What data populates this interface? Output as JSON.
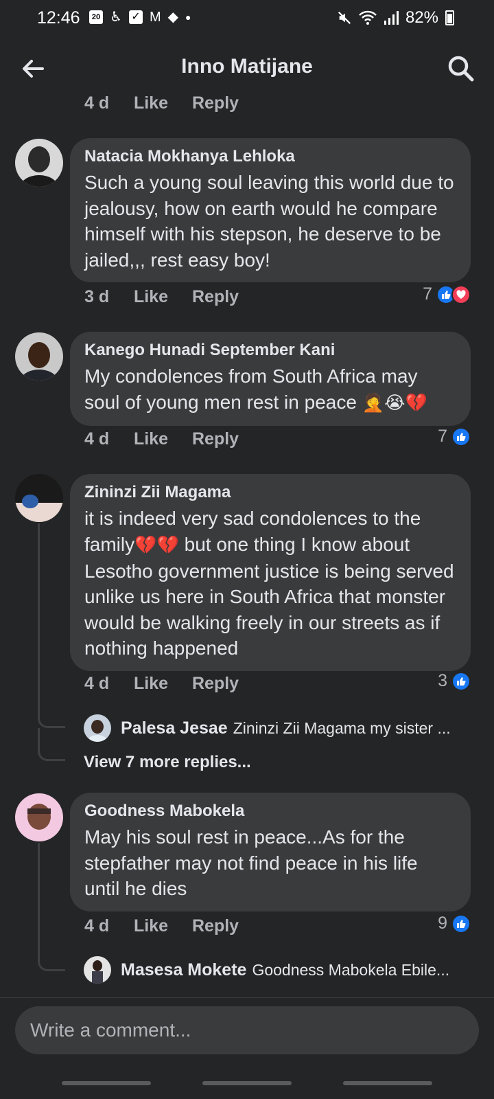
{
  "status_bar": {
    "time": "12:46",
    "battery": "82%",
    "notification_icons": [
      "calendar-icon",
      "accessibility-icon",
      "check-icon",
      "gmail-icon",
      "diamond-icon",
      "dot-icon"
    ],
    "calendar_day": "20"
  },
  "header": {
    "title": "Inno Matijane"
  },
  "comments": [
    {
      "time": "4 d",
      "like": "Like",
      "reply": "Reply"
    },
    {
      "author": "Natacia Mokhanya Lehloka",
      "text": "Such a young soul leaving this world due to jealousy, how on earth would he compare himself with his stepson, he deserve to be jailed,,, rest easy boy!",
      "time": "3 d",
      "like": "Like",
      "reply": "Reply",
      "reactions_count": "7",
      "reactions": [
        "like-icon",
        "love-icon"
      ]
    },
    {
      "author": "Kanego Hunadi September Kani",
      "text": "My condolences from South Africa may soul of young men rest in peace",
      "emojis": [
        "🤦",
        "😭",
        "💔"
      ],
      "time": "4 d",
      "like": "Like",
      "reply": "Reply",
      "reactions_count": "7",
      "reactions": [
        "like-icon"
      ]
    },
    {
      "author": "Zininzi Zii Magama",
      "text_before": "it is indeed very sad condolences to the family",
      "emojis": [
        "💔",
        "💔"
      ],
      "text_after": " but one thing I know about Lesotho government justice is being served unlike us here in South Africa that monster would be walking freely in our streets as if nothing happened",
      "time": "4 d",
      "like": "Like",
      "reply": "Reply",
      "reactions_count": "3",
      "reactions": [
        "like-icon"
      ],
      "reply_preview": {
        "author": "Palesa Jesae",
        "text": "Zininzi Zii Magama my sister ..."
      },
      "view_more": "View 7 more replies..."
    },
    {
      "author": "Goodness Mabokela",
      "text": "May his soul rest in peace...As for the stepfather may not find peace in his life until he dies",
      "time": "4 d",
      "like": "Like",
      "reply": "Reply",
      "reactions_count": "9",
      "reactions": [
        "like-icon"
      ],
      "reply_preview": {
        "author": "Masesa Mokete",
        "text": "Goodness Mabokela Ebile..."
      }
    }
  ],
  "composer": {
    "placeholder": "Write a comment..."
  },
  "colors": {
    "background": "#242526",
    "bubble": "#3a3b3c",
    "like_blue": "#1877f2",
    "love_red": "#f33e58"
  }
}
